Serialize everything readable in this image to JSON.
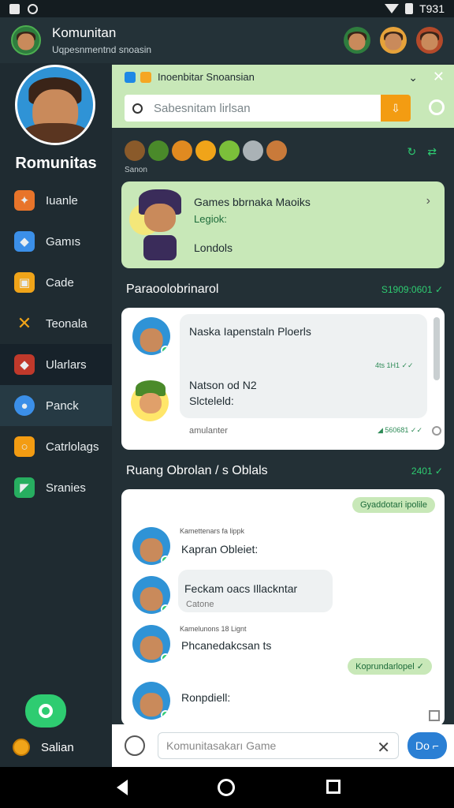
{
  "status": {
    "time": "T931"
  },
  "appbar": {
    "title": "Komunitan",
    "subtitle": "Uqpesnmentnd snoasin"
  },
  "sidebar": {
    "profile_name": "Romunitas",
    "items": [
      {
        "label": "Iuanle",
        "icon": "gift-icon",
        "color": "#e8742a"
      },
      {
        "label": "Gamıs",
        "icon": "cube-icon",
        "color": "#3b8fe8"
      },
      {
        "label": "Cade",
        "icon": "box-icon",
        "color": "#f0a419"
      },
      {
        "label": "Teonala",
        "icon": "cross-swords-icon",
        "color": "#f0a419"
      },
      {
        "label": "Ularlars",
        "icon": "cube-red-icon",
        "color": "#c0392b"
      },
      {
        "label": "Panck",
        "icon": "globe-icon",
        "color": "#3b8fe8"
      },
      {
        "label": "Catrlolags",
        "icon": "ring-icon",
        "color": "#f39c12"
      },
      {
        "label": "Sranies",
        "icon": "gem-icon",
        "color": "#27ae60"
      }
    ],
    "bottom_label": "Salian"
  },
  "search_panel": {
    "title": "Inoenbitar Snoansian",
    "placeholder": "Sabesnitam lirlsan",
    "button_glyph": "⇩"
  },
  "emoji_caption": "Sanon",
  "featured": {
    "title": "Games bbrnaka Maoiks",
    "subtitle": "Legiok:",
    "footer": "Londols"
  },
  "section1": {
    "title": "Paraoolobrinarol",
    "meta": "S1909:0601 ✓"
  },
  "chat1": {
    "msg1": "Naska Iapenstaln Ploerls",
    "time1": "4ts 1H1 ✓✓",
    "msg2": "Natson od N2",
    "msg3": "Slcteleld:",
    "footer": "amulanter",
    "footer_meta": "◢ 560681 ✓✓"
  },
  "section2": {
    "title": "Ruang Obrolan / s Oblals",
    "meta": "2401 ✓"
  },
  "chat2": {
    "top_bubble": "Gyaddotari ipolile",
    "m1_name": "Kamettenars fa lippk",
    "m1_text": "Kapran Obleiet:",
    "m2_text": "Feckam oacs Illackntar",
    "m2_sub": "Catone",
    "m3_name": "Kamelunons 18 Lignt",
    "m3_text": "Phcanedakcsan ts",
    "right_bubble": "Koprundarlopel ✓",
    "m4_text": "Ronpdiell:"
  },
  "composer": {
    "placeholder": "Komunitasakarı Game",
    "send_label": "Do ⌐"
  }
}
